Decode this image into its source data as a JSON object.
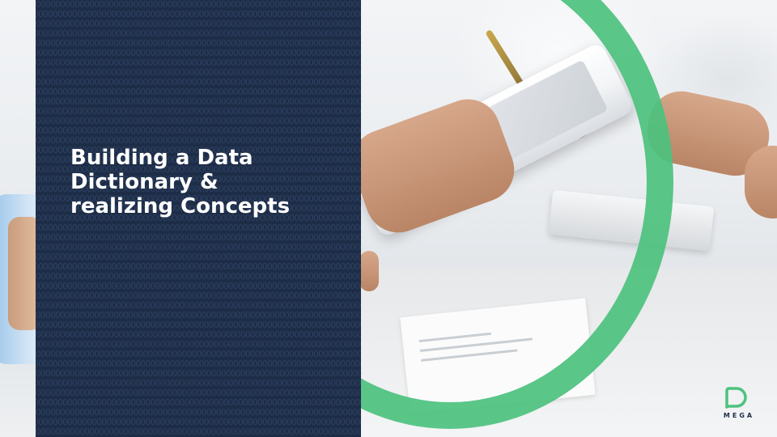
{
  "slide": {
    "title_lines": [
      "Building a Data",
      "Dictionary &",
      "realizing Concepts"
    ],
    "background_image": "office-tablet-photo"
  },
  "logo": {
    "text": "MEGA",
    "icon": "mega-logo-icon"
  },
  "pattern": {
    "glyph": "O"
  },
  "colors": {
    "panel": "#1e2d47",
    "accent_ring": "#4dc27e",
    "title": "#ffffff",
    "logo_text": "#1e2d47"
  }
}
